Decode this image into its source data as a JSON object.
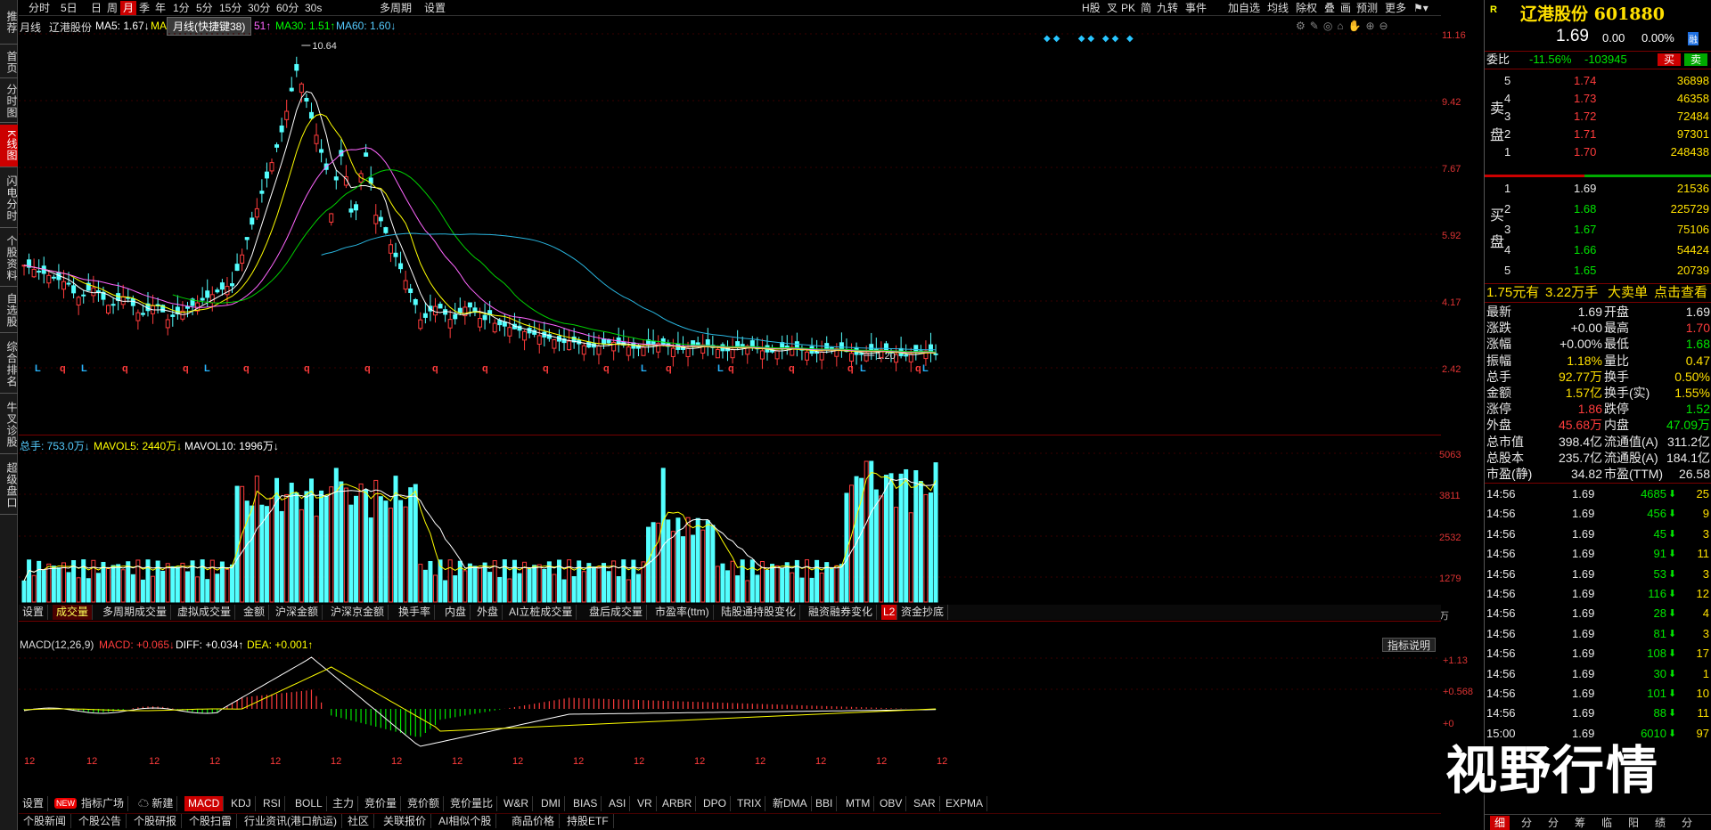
{
  "left_tabs": [
    "推荐",
    "首页",
    "分时图",
    "K线图",
    "闪电分时",
    "个股资料",
    "自选股",
    "综合排名",
    "牛叉诊股",
    "超级盘口"
  ],
  "toolbar": {
    "periods": [
      "分时",
      "5日",
      "日",
      "周",
      "月",
      "季",
      "年",
      "1分",
      "5分",
      "15分",
      "30分",
      "60分",
      "30s",
      "多周期",
      "设置"
    ],
    "active_period": "月",
    "right_items": [
      "H股",
      "叉",
      "PK",
      "简",
      "九转",
      "事件",
      "加自选",
      "均线",
      "除权",
      "叠",
      "画",
      "预测",
      "更多"
    ]
  },
  "main_chart": {
    "period_label": "月线",
    "stock_name": "辽港股份",
    "ma5": "MA5: 1.67↓",
    "ma_hidden": "MA",
    "ma_mid": "51↑",
    "ma30": "MA30: 1.51↑",
    "ma60": "MA60: 1.60↓",
    "tooltip": "月线(快捷键38)",
    "high_marker": "10.64",
    "low_marker": "1.20",
    "y_ticks": [
      "11.16",
      "9.42",
      "7.67",
      "5.92",
      "4.17",
      "2.42"
    ],
    "marker_row": [
      "L",
      "q",
      "L",
      "q",
      "q",
      "L",
      "q",
      "q",
      "q",
      "q",
      "q",
      "q",
      "q",
      "L",
      "q",
      "L",
      "q",
      "q",
      "q",
      "L",
      "q",
      "L"
    ]
  },
  "volume_chart": {
    "total": "总手: 753.0万↓",
    "mavol5": "MAVOL5: 2440万↓",
    "mavol10": "MAVOL10: 1996万↓",
    "y_ticks": [
      "5063",
      "3811",
      "2532",
      "1279"
    ],
    "unit": "万",
    "tabs": [
      "设置",
      "成交量",
      "多周期成交量",
      "虚拟成交量",
      "金额",
      "沪深金额",
      "沪深京金额",
      "换手率",
      "内盘",
      "外盘",
      "AI立桩成交量",
      "盘后成交量",
      "市盈率(ttm)",
      "陆股通持股变化",
      "融资融券变化",
      "L2",
      "资金抄底"
    ],
    "active_tab": "成交量"
  },
  "macd_chart": {
    "title": "MACD(12,26,9)",
    "macd": "MACD: +0.065↓",
    "diff": "DIFF: +0.034↑",
    "dea": "DEA: +0.001↑",
    "explain_button": "指标说明",
    "y_ticks": [
      "+1.13",
      "+0.568",
      "+0"
    ],
    "x_ticks": [
      "12",
      "12",
      "12",
      "12",
      "12",
      "12",
      "12",
      "12",
      "12",
      "12",
      "12",
      "12",
      "12",
      "12",
      "12",
      "12"
    ]
  },
  "indicator_tabs": {
    "settings": "设置",
    "new_badge": "NEW",
    "items": [
      "指标广场",
      "新建",
      "MACD",
      "KDJ",
      "RSI",
      "BOLL",
      "主力",
      "竞价量",
      "竞价额",
      "竞价量比",
      "W&R",
      "DMI",
      "BIAS",
      "ASI",
      "VR",
      "ARBR",
      "DPO",
      "TRIX",
      "新DMA",
      "BBI",
      "MTM",
      "OBV",
      "SAR",
      "EXPMA"
    ],
    "active": "MACD"
  },
  "bottom_links": [
    "个股新闻",
    "个股公告",
    "个股研报",
    "个股扫雷",
    "行业资讯(港口航运)",
    "社区",
    "关联报价",
    "AI相似个股",
    "商品价格",
    "持股ETF"
  ],
  "watermark": "视野行情",
  "quote": {
    "badge": "R",
    "name_code": "辽港股份 601880",
    "price": "1.69",
    "change": "0.00",
    "change_pct": "0.00%",
    "hk_badge": "融",
    "weibi_label": "委比",
    "weibi_pct": "-11.56%",
    "weibi_diff": "-103945",
    "buy_btn": "买",
    "sell_btn": "卖",
    "sell_label": "卖盘",
    "buy_label": "买盘",
    "asks": [
      {
        "level": "5",
        "price": "1.74",
        "vol": "36898"
      },
      {
        "level": "4",
        "price": "1.73",
        "vol": "46358"
      },
      {
        "level": "3",
        "price": "1.72",
        "vol": "72484"
      },
      {
        "level": "2",
        "price": "1.71",
        "vol": "97301"
      },
      {
        "level": "1",
        "price": "1.70",
        "vol": "248438"
      }
    ],
    "bids": [
      {
        "level": "1",
        "price": "1.69",
        "vol": "21536"
      },
      {
        "level": "2",
        "price": "1.68",
        "vol": "225729"
      },
      {
        "level": "3",
        "price": "1.67",
        "vol": "75106"
      },
      {
        "level": "4",
        "price": "1.66",
        "vol": "54424"
      },
      {
        "level": "5",
        "price": "1.65",
        "vol": "20739"
      }
    ],
    "big_order": {
      "price": "1.75元有",
      "vol": "3.22万手",
      "label": "大卖单",
      "link": "点击查看"
    },
    "stats_left": [
      {
        "k": "最新",
        "v": "1.69",
        "c": "white"
      },
      {
        "k": "涨跌",
        "v": "+0.00",
        "c": "white"
      },
      {
        "k": "涨幅",
        "v": "+0.00%",
        "c": "white"
      },
      {
        "k": "振幅",
        "v": "1.18%",
        "c": "yellow"
      },
      {
        "k": "总手",
        "v": "92.77万",
        "c": "yellow"
      },
      {
        "k": "金额",
        "v": "1.57亿",
        "c": "yellow"
      },
      {
        "k": "涨停",
        "v": "1.86",
        "c": "red"
      },
      {
        "k": "外盘",
        "v": "45.68万",
        "c": "red"
      },
      {
        "k": "总市值",
        "v": "398.4亿",
        "c": "white"
      },
      {
        "k": "总股本",
        "v": "235.7亿",
        "c": "white"
      },
      {
        "k": "市盈(静)",
        "v": "34.82",
        "c": "white"
      }
    ],
    "stats_right": [
      {
        "k": "开盘",
        "v": "1.69",
        "c": "white"
      },
      {
        "k": "最高",
        "v": "1.70",
        "c": "red"
      },
      {
        "k": "最低",
        "v": "1.68",
        "c": "green"
      },
      {
        "k": "量比",
        "v": "0.47",
        "c": "yellow"
      },
      {
        "k": "换手",
        "v": "0.50%",
        "c": "yellow"
      },
      {
        "k": "换手(实)",
        "v": "1.55%",
        "c": "yellow"
      },
      {
        "k": "跌停",
        "v": "1.52",
        "c": "green"
      },
      {
        "k": "内盘",
        "v": "47.09万",
        "c": "green"
      },
      {
        "k": "流通值(A)",
        "v": "311.2亿",
        "c": "white"
      },
      {
        "k": "流通股(A)",
        "v": "184.1亿",
        "c": "white"
      },
      {
        "k": "市盈(TTM)",
        "v": "26.58",
        "c": "white"
      }
    ],
    "ticks": [
      {
        "t": "14:56",
        "p": "1.69",
        "v": "4685",
        "d": "down",
        "n": "25"
      },
      {
        "t": "14:56",
        "p": "1.69",
        "v": "456",
        "d": "down",
        "n": "9"
      },
      {
        "t": "14:56",
        "p": "1.69",
        "v": "45",
        "d": "down",
        "n": "3"
      },
      {
        "t": "14:56",
        "p": "1.69",
        "v": "91",
        "d": "down",
        "n": "11"
      },
      {
        "t": "14:56",
        "p": "1.69",
        "v": "53",
        "d": "down",
        "n": "3"
      },
      {
        "t": "14:56",
        "p": "1.69",
        "v": "116",
        "d": "down",
        "n": "12"
      },
      {
        "t": "14:56",
        "p": "1.69",
        "v": "28",
        "d": "down",
        "n": "4"
      },
      {
        "t": "14:56",
        "p": "1.69",
        "v": "81",
        "d": "down",
        "n": "3"
      },
      {
        "t": "14:56",
        "p": "1.69",
        "v": "108",
        "d": "down",
        "n": "17"
      },
      {
        "t": "14:56",
        "p": "1.69",
        "v": "30",
        "d": "down",
        "n": "1"
      },
      {
        "t": "14:56",
        "p": "1.69",
        "v": "101",
        "d": "down",
        "n": "10"
      },
      {
        "t": "14:56",
        "p": "1.69",
        "v": "88",
        "d": "down",
        "n": "11"
      },
      {
        "t": "15:00",
        "p": "1.69",
        "v": "6010",
        "d": "down",
        "n": "97"
      }
    ],
    "tick_bottom_tabs": [
      "细",
      "分",
      "分",
      "筹",
      "临",
      "阳",
      "绩",
      "分"
    ]
  }
}
